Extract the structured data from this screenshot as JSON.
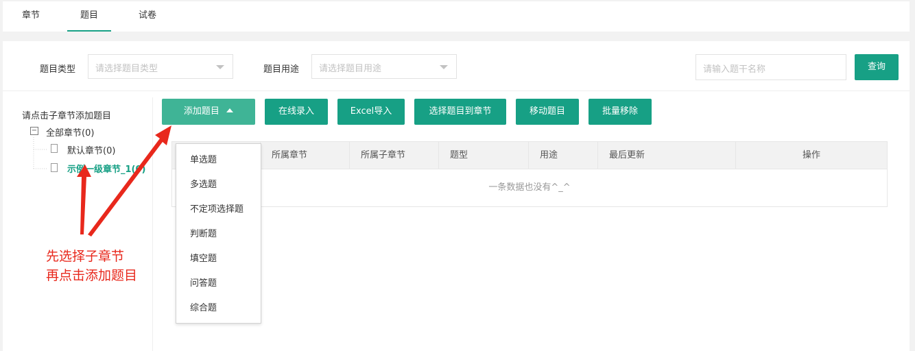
{
  "tabs": [
    {
      "label": "章节"
    },
    {
      "label": "题目"
    },
    {
      "label": "试卷"
    }
  ],
  "filters": {
    "type_label": "题目类型",
    "type_placeholder": "请选择题目类型",
    "usage_label": "题目用途",
    "usage_placeholder": "请选择题目用途",
    "search_placeholder": "请输入题干名称",
    "search_button": "查询"
  },
  "tree": {
    "hint": "请点击子章节添加题目",
    "root_toggle": "−",
    "root": "全部章节(0)",
    "children": [
      {
        "label": "默认章节(0)"
      },
      {
        "label": "示例一级章节_1(0)"
      }
    ]
  },
  "toolbar": {
    "add": "添加题目",
    "online": "在线录入",
    "excel": "Excel导入",
    "select": "选择题目到章节",
    "move": "移动题目",
    "remove": "批量移除"
  },
  "table": {
    "columns": [
      "所属章节",
      "所属子章节",
      "题型",
      "用途",
      "最后更新",
      "操作"
    ],
    "empty_text": "一条数据也没有^_^"
  },
  "dropdown": {
    "items": [
      "单选题",
      "多选题",
      "不定项选择题",
      "判断题",
      "填空题",
      "问答题",
      "综合题"
    ]
  },
  "annotation": {
    "line1": "先选择子章节",
    "line2": "再点击添加题目"
  },
  "colors": {
    "accent": "#17a085",
    "accent_light": "#3fb496",
    "annotation": "#e8281c"
  }
}
